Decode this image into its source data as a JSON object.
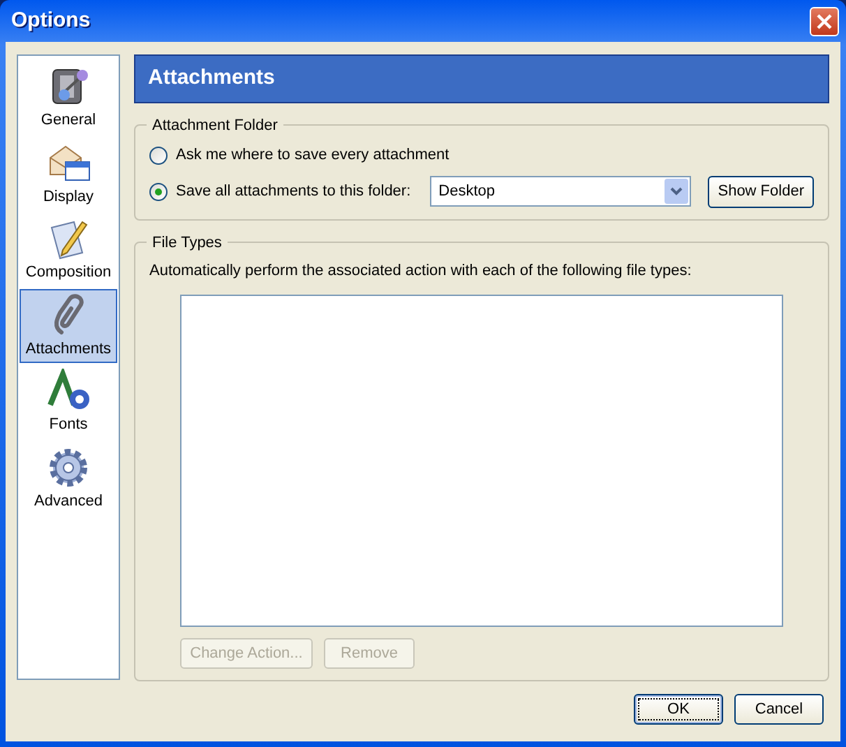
{
  "window": {
    "title": "Options"
  },
  "sidebar": {
    "items": [
      {
        "label": "General",
        "selected": false
      },
      {
        "label": "Display",
        "selected": false
      },
      {
        "label": "Composition",
        "selected": false
      },
      {
        "label": "Attachments",
        "selected": true
      },
      {
        "label": "Fonts",
        "selected": false
      },
      {
        "label": "Advanced",
        "selected": false
      }
    ]
  },
  "panel": {
    "title": "Attachments"
  },
  "attachment_folder": {
    "legend": "Attachment Folder",
    "options": [
      {
        "label": "Ask me where to save every attachment",
        "selected": false
      },
      {
        "label": "Save all attachments to this folder:",
        "selected": true
      }
    ],
    "folder": {
      "value": "Desktop"
    },
    "button": "Show Folder"
  },
  "file_types": {
    "legend": "File Types",
    "description": "Automatically perform the associated action with each of the following file types:",
    "buttons": [
      {
        "label": "Change Action...",
        "disabled": true
      },
      {
        "label": "Remove",
        "disabled": true
      }
    ]
  },
  "footer_buttons": [
    {
      "label": "OK",
      "default": true
    },
    {
      "label": "Cancel",
      "default": false
    }
  ]
}
